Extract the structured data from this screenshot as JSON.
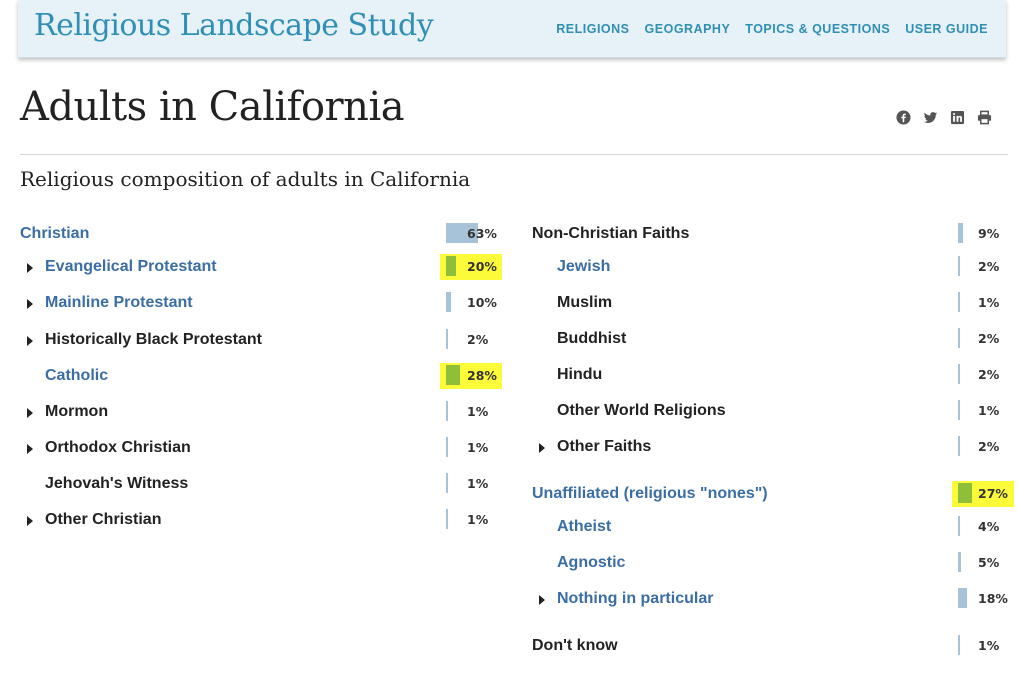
{
  "header": {
    "site_title": "Religious Landscape Study",
    "nav": [
      "RELIGIONS",
      "GEOGRAPHY",
      "TOPICS & QUESTIONS",
      "USER GUIDE"
    ]
  },
  "page": {
    "title": "Adults in California",
    "subtitle": "Religious composition of adults in California",
    "share_icons": [
      "facebook-icon",
      "twitter-icon",
      "linkedin-icon",
      "print-icon"
    ]
  },
  "left_column": [
    {
      "label": "Christian",
      "value": "63%",
      "pct": 63,
      "level": 0,
      "expandable": false,
      "link": true,
      "highlight": false
    },
    {
      "label": "Evangelical Protestant",
      "value": "20%",
      "pct": 20,
      "level": 1,
      "expandable": true,
      "link": true,
      "highlight": true
    },
    {
      "label": "Mainline Protestant",
      "value": "10%",
      "pct": 10,
      "level": 1,
      "expandable": true,
      "link": true,
      "highlight": false
    },
    {
      "label": "Historically Black Protestant",
      "value": "2%",
      "pct": 2,
      "level": 1,
      "expandable": true,
      "link": false,
      "highlight": false
    },
    {
      "label": "Catholic",
      "value": "28%",
      "pct": 28,
      "level": 1,
      "expandable": false,
      "link": true,
      "highlight": true
    },
    {
      "label": "Mormon",
      "value": "1%",
      "pct": 1,
      "level": 1,
      "expandable": true,
      "link": false,
      "highlight": false
    },
    {
      "label": "Orthodox Christian",
      "value": "1%",
      "pct": 1,
      "level": 1,
      "expandable": true,
      "link": false,
      "highlight": false
    },
    {
      "label": "Jehovah's Witness",
      "value": "1%",
      "pct": 1,
      "level": 1,
      "expandable": false,
      "link": false,
      "highlight": false
    },
    {
      "label": "Other Christian",
      "value": "1%",
      "pct": 1,
      "level": 1,
      "expandable": true,
      "link": false,
      "highlight": false
    }
  ],
  "right_column": [
    {
      "label": "Non-Christian Faiths",
      "value": "9%",
      "pct": 9,
      "level": 0,
      "expandable": false,
      "link": false,
      "highlight": false
    },
    {
      "label": "Jewish",
      "value": "2%",
      "pct": 2,
      "level": 1,
      "expandable": false,
      "link": true,
      "highlight": false
    },
    {
      "label": "Muslim",
      "value": "1%",
      "pct": 1,
      "level": 1,
      "expandable": false,
      "link": false,
      "highlight": false
    },
    {
      "label": "Buddhist",
      "value": "2%",
      "pct": 2,
      "level": 1,
      "expandable": false,
      "link": false,
      "highlight": false
    },
    {
      "label": "Hindu",
      "value": "2%",
      "pct": 2,
      "level": 1,
      "expandable": false,
      "link": false,
      "highlight": false
    },
    {
      "label": "Other World Religions",
      "value": "1%",
      "pct": 1,
      "level": 1,
      "expandable": false,
      "link": false,
      "highlight": false
    },
    {
      "label": "Other Faiths",
      "value": "2%",
      "pct": 2,
      "level": 1,
      "expandable": true,
      "link": false,
      "highlight": false
    },
    {
      "label": "Unaffiliated (religious \"nones\")",
      "value": "27%",
      "pct": 27,
      "level": 0,
      "expandable": false,
      "link": true,
      "highlight": true
    },
    {
      "label": "Atheist",
      "value": "4%",
      "pct": 4,
      "level": 1,
      "expandable": false,
      "link": true,
      "highlight": false
    },
    {
      "label": "Agnostic",
      "value": "5%",
      "pct": 5,
      "level": 1,
      "expandable": false,
      "link": true,
      "highlight": false
    },
    {
      "label": "Nothing in particular",
      "value": "18%",
      "pct": 18,
      "level": 1,
      "expandable": true,
      "link": true,
      "highlight": false
    },
    {
      "label": "Don't know",
      "value": "1%",
      "pct": 1,
      "level": 0,
      "expandable": false,
      "link": false,
      "highlight": false
    }
  ],
  "colors": {
    "header_bg": "#e7f1f8",
    "brand_blue": "#2f8fb5",
    "link_blue": "#3a6ea5",
    "bar_blue": "#a7c3d9",
    "highlight": "#fbfb3a"
  }
}
